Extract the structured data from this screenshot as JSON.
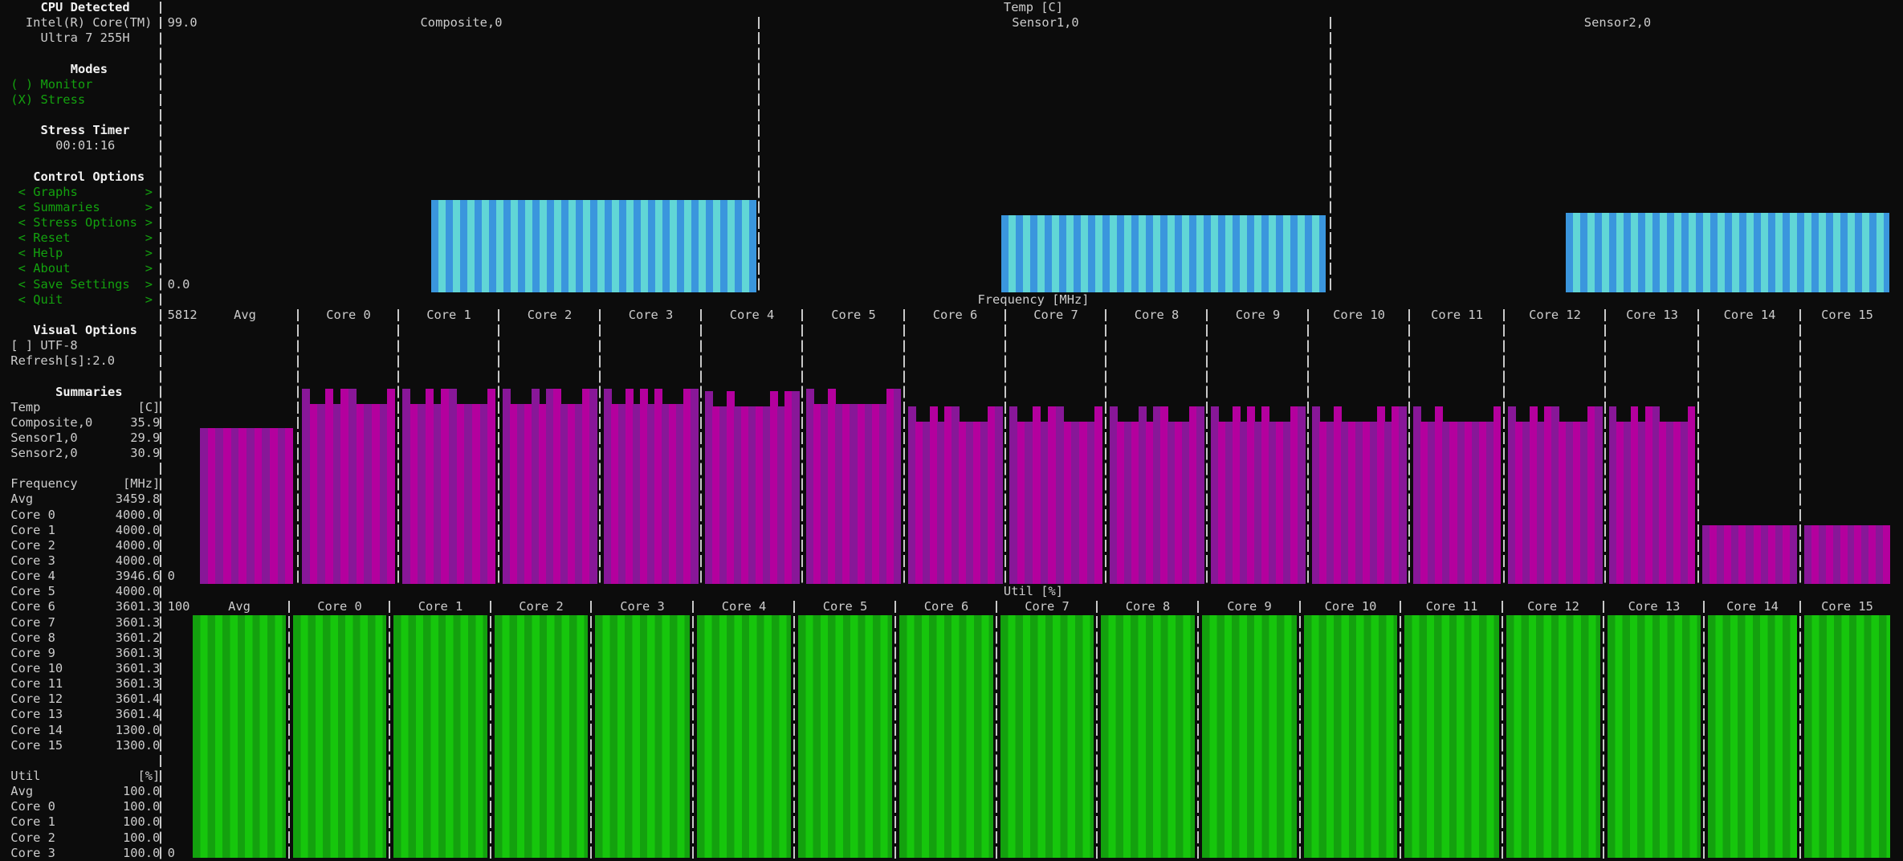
{
  "sidebar": {
    "cpu": {
      "title": "CPU Detected",
      "line1": "Intel(R) Core(TM)",
      "line2": "Ultra 7 255H"
    },
    "modes": {
      "title": "Modes",
      "options": [
        {
          "radio": "( )",
          "label": "Monitor"
        },
        {
          "radio": "(X)",
          "label": "Stress"
        }
      ]
    },
    "stress_timer": {
      "title": "Stress Timer",
      "value": "00:01:16"
    },
    "control": {
      "title": "Control Options",
      "items": [
        {
          "label": "Graphs"
        },
        {
          "label": "Summaries"
        },
        {
          "label": "Stress Options"
        },
        {
          "label": "Reset"
        },
        {
          "label": "Help"
        },
        {
          "label": "About"
        },
        {
          "label": "Save Settings"
        },
        {
          "label": "Quit"
        }
      ],
      "left_bracket": "<",
      "right_bracket": ">"
    },
    "visual": {
      "title": "Visual Options",
      "utf8": "[ ] UTF-8",
      "refresh": "Refresh[s]:2.0"
    },
    "summaries": {
      "title": "Summaries",
      "temp": {
        "label": "Temp",
        "unit": "[C]",
        "rows": [
          {
            "name": "Composite,0",
            "value": "35.9"
          },
          {
            "name": "Sensor1,0",
            "value": "29.9"
          },
          {
            "name": "Sensor2,0",
            "value": "30.9"
          }
        ]
      },
      "freq": {
        "label": "Frequency",
        "unit": "[MHz]",
        "rows": [
          {
            "name": "Avg",
            "value": "3459.8"
          },
          {
            "name": "Core 0",
            "value": "4000.0"
          },
          {
            "name": "Core 1",
            "value": "4000.0"
          },
          {
            "name": "Core 2",
            "value": "4000.0"
          },
          {
            "name": "Core 3",
            "value": "4000.0"
          },
          {
            "name": "Core 4",
            "value": "3946.6"
          },
          {
            "name": "Core 5",
            "value": "4000.0"
          },
          {
            "name": "Core 6",
            "value": "3601.3"
          },
          {
            "name": "Core 7",
            "value": "3601.3"
          },
          {
            "name": "Core 8",
            "value": "3601.2"
          },
          {
            "name": "Core 9",
            "value": "3601.3"
          },
          {
            "name": "Core 10",
            "value": "3601.3"
          },
          {
            "name": "Core 11",
            "value": "3601.3"
          },
          {
            "name": "Core 12",
            "value": "3601.4"
          },
          {
            "name": "Core 13",
            "value": "3601.4"
          },
          {
            "name": "Core 14",
            "value": "1300.0"
          },
          {
            "name": "Core 15",
            "value": "1300.0"
          }
        ]
      },
      "util": {
        "label": "Util",
        "unit": "[%]",
        "rows": [
          {
            "name": "Avg",
            "value": "100.0"
          },
          {
            "name": "Core 0",
            "value": "100.0"
          },
          {
            "name": "Core 1",
            "value": "100.0"
          },
          {
            "name": "Core 2",
            "value": "100.0"
          },
          {
            "name": "Core 3",
            "value": "100.0"
          }
        ]
      }
    }
  },
  "colors": {
    "background": "#0c0c0c",
    "text": "#cccccc",
    "green_text": "#13a10e",
    "temp_bar": [
      "#3a96dd",
      "#61d6d6"
    ],
    "freq_bar": [
      "#881798",
      "#b4009e"
    ],
    "util_bar": [
      "#13a10e",
      "#16c60c"
    ]
  },
  "chart_data": [
    {
      "type": "bar",
      "title": "Temp [C]",
      "ymax_label": "99.0",
      "ymin_label": "0.0",
      "ylim": [
        0,
        99
      ],
      "categories": [
        "Composite,0",
        "Sensor1,0",
        "Sensor2,0"
      ],
      "values": [
        35.9,
        29.9,
        30.9
      ]
    },
    {
      "type": "bar",
      "title": "Frequency [MHz]",
      "ymax_label": "5812",
      "ymin_label": "0",
      "ylim": [
        0,
        5812
      ],
      "categories": [
        "Avg",
        "Core 0",
        "Core 1",
        "Core 2",
        "Core 3",
        "Core 4",
        "Core 5",
        "Core 6",
        "Core 7",
        "Core 8",
        "Core 9",
        "Core 10",
        "Core 11",
        "Core 12",
        "Core 13",
        "Core 14",
        "Core 15"
      ],
      "values": [
        3459.8,
        4000.0,
        4000.0,
        4000.0,
        4000.0,
        3946.6,
        4000.0,
        3601.3,
        3601.3,
        3601.2,
        3601.3,
        3601.3,
        3601.3,
        3601.4,
        3601.4,
        1300.0,
        1300.0
      ]
    },
    {
      "type": "bar",
      "title": "Util [%]",
      "ymax_label": "100",
      "ymin_label": "0",
      "ylim": [
        0,
        100
      ],
      "categories": [
        "Avg",
        "Core 0",
        "Core 1",
        "Core 2",
        "Core 3",
        "Core 4",
        "Core 5",
        "Core 6",
        "Core 7",
        "Core 8",
        "Core 9",
        "Core 10",
        "Core 11",
        "Core 12",
        "Core 13",
        "Core 14",
        "Core 15"
      ],
      "values": [
        100,
        100,
        100,
        100,
        100,
        100,
        100,
        100,
        100,
        100,
        100,
        100,
        100,
        100,
        100,
        100,
        100
      ]
    }
  ]
}
